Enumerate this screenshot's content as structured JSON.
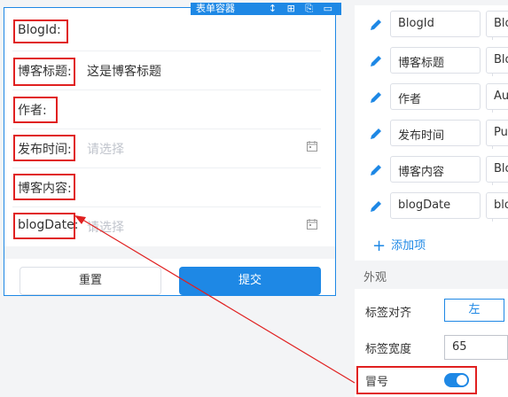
{
  "container": {
    "tag_label": "表单容器",
    "tag_icons": "↕ ⊞ ⎘ ▭"
  },
  "form": {
    "rows": [
      {
        "label": "BlogId:",
        "value": "",
        "placeholder": ""
      },
      {
        "label": "博客标题:",
        "value": "这是博客标题",
        "placeholder": ""
      },
      {
        "label": "作者:",
        "value": "",
        "placeholder": ""
      },
      {
        "label": "发布时间:",
        "value": "",
        "placeholder": "请选择"
      },
      {
        "label": "博客内容:",
        "value": "",
        "placeholder": ""
      },
      {
        "label": "blogDate:",
        "value": "",
        "placeholder": "请选择"
      }
    ],
    "reset_label": "重置",
    "submit_label": "提交"
  },
  "fields": [
    {
      "name": "BlogId",
      "prop": "Blo"
    },
    {
      "name": "博客标题",
      "prop": "Blo"
    },
    {
      "name": "作者",
      "prop": "Au"
    },
    {
      "name": "发布时间",
      "prop": "Pu"
    },
    {
      "name": "博客内容",
      "prop": "Blo"
    },
    {
      "name": "blogDate",
      "prop": "blo"
    }
  ],
  "add_item_label": "添加项",
  "appearance": {
    "section_title": "外观",
    "label_align_label": "标签对齐",
    "label_align_value": "左",
    "label_width_label": "标签宽度",
    "label_width_value": "65",
    "colon_label": "冒号",
    "colon_enabled": true
  },
  "colors": {
    "accent": "#1e88e5",
    "annotation": "#e02020"
  }
}
